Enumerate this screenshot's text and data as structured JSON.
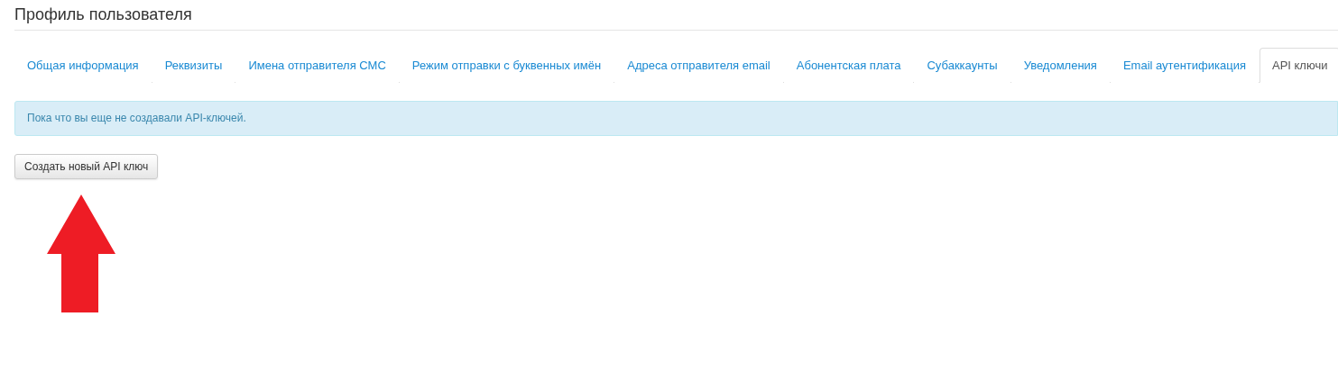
{
  "page_title": "Профиль пользователя",
  "tabs": [
    {
      "label": "Общая информация",
      "selected": false
    },
    {
      "label": "Реквизиты",
      "selected": false
    },
    {
      "label": "Имена отправителя СМС",
      "selected": false
    },
    {
      "label": "Режим отправки с буквенных имён",
      "selected": false
    },
    {
      "label": "Адреса отправителя email",
      "selected": false
    },
    {
      "label": "Абонентская плата",
      "selected": false
    },
    {
      "label": "Субаккаунты",
      "selected": false
    },
    {
      "label": "Уведомления",
      "selected": false
    },
    {
      "label": "Email аутентификация",
      "selected": false
    },
    {
      "label": "API ключи",
      "selected": true
    }
  ],
  "alert": "Пока что вы еще не создавали API-ключей.",
  "create_button": "Создать новый API ключ"
}
